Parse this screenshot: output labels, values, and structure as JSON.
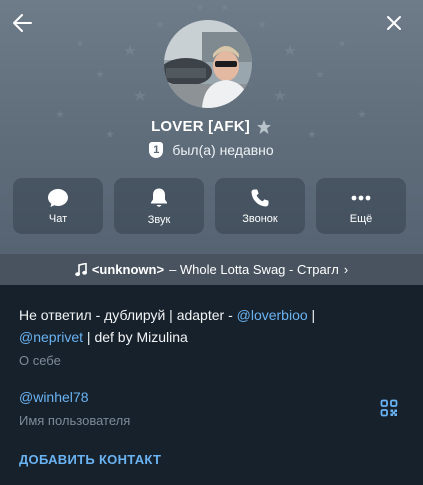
{
  "profile": {
    "name": "LOVER [AFK]",
    "status_badge": "1",
    "status": "был(а) недавно"
  },
  "actions": {
    "chat": "Чат",
    "sound": "Звук",
    "call": "Звонок",
    "more": "Ещё"
  },
  "music": {
    "artist": "<unknown>",
    "rest": "– Whole Lotta Swag - Страгл",
    "arrow": "›"
  },
  "bio": {
    "text_1": "Не ответил - дублируй | adapter - ",
    "link_1": "@loverbioo",
    "text_2": " | ",
    "link_2": "@neprivet",
    "text_3": " | def by Mizulina",
    "caption": "О себе"
  },
  "username": {
    "value": "@winhel78",
    "caption": "Имя пользователя"
  },
  "add_contact": "ДОБАВИТЬ КОНТАКТ",
  "icons": {
    "back": "arrow-left-icon",
    "close": "close-icon",
    "premium": "star-icon",
    "chat": "chat-bubble-icon",
    "sound": "bell-icon",
    "call": "phone-icon",
    "more": "more-dots-icon",
    "music": "music-note-icon",
    "qr": "qr-code-icon"
  },
  "colors": {
    "background": "#17212b",
    "header": "#65737f",
    "link": "#6ab3f3",
    "caption": "#7d8b99",
    "music_bar": "#48535f"
  }
}
